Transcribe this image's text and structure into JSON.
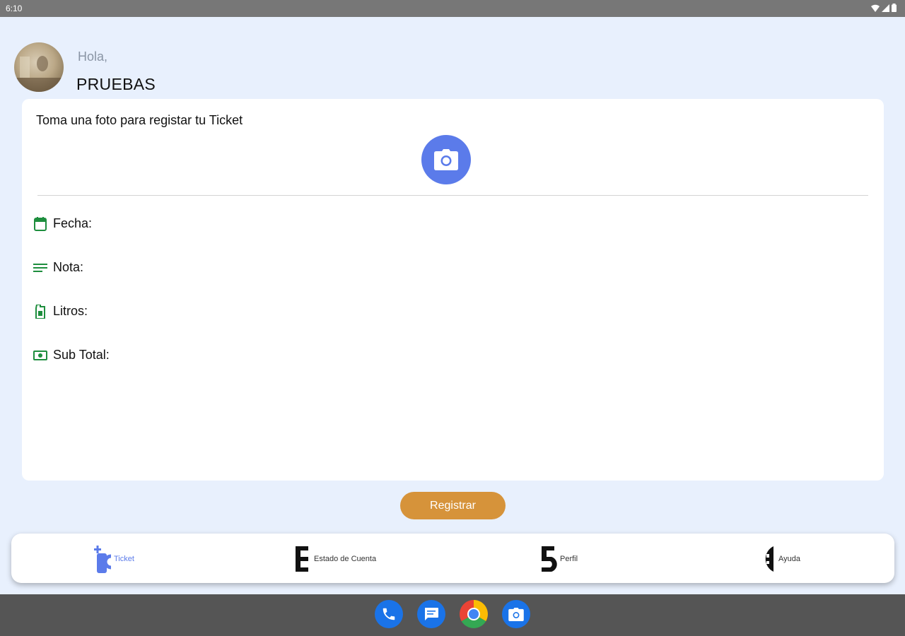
{
  "status_bar": {
    "time": "6:10",
    "icons": [
      "wifi-icon",
      "signal-icon",
      "battery-icon"
    ]
  },
  "header": {
    "greeting": "Hola,",
    "user_name": "PRUEBAS"
  },
  "ticket_card": {
    "title": "Toma una foto para registar tu Ticket",
    "camera_icon": "camera-icon",
    "fields": [
      {
        "icon": "calendar-icon",
        "label": "Fecha:"
      },
      {
        "icon": "notes-icon",
        "label": "Nota:"
      },
      {
        "icon": "fuel-icon",
        "label": "Litros:"
      },
      {
        "icon": "money-icon",
        "label": "Sub Total:"
      }
    ]
  },
  "register_button": {
    "label": "Registrar"
  },
  "bottom_nav": {
    "items": [
      {
        "label": "Ticket",
        "active": true
      },
      {
        "label": "Estado de Cuenta",
        "active": false
      },
      {
        "label": "Perfil",
        "active": false
      },
      {
        "label": "Ayuda",
        "active": false
      }
    ]
  },
  "dock": {
    "apps": [
      "phone-icon",
      "messages-icon",
      "chrome-icon",
      "camera-app-icon"
    ]
  },
  "colors": {
    "accent": "#5b7bea",
    "button": "#d6933a",
    "field_icon": "#1e8e3e",
    "background": "#e8f0fd"
  }
}
